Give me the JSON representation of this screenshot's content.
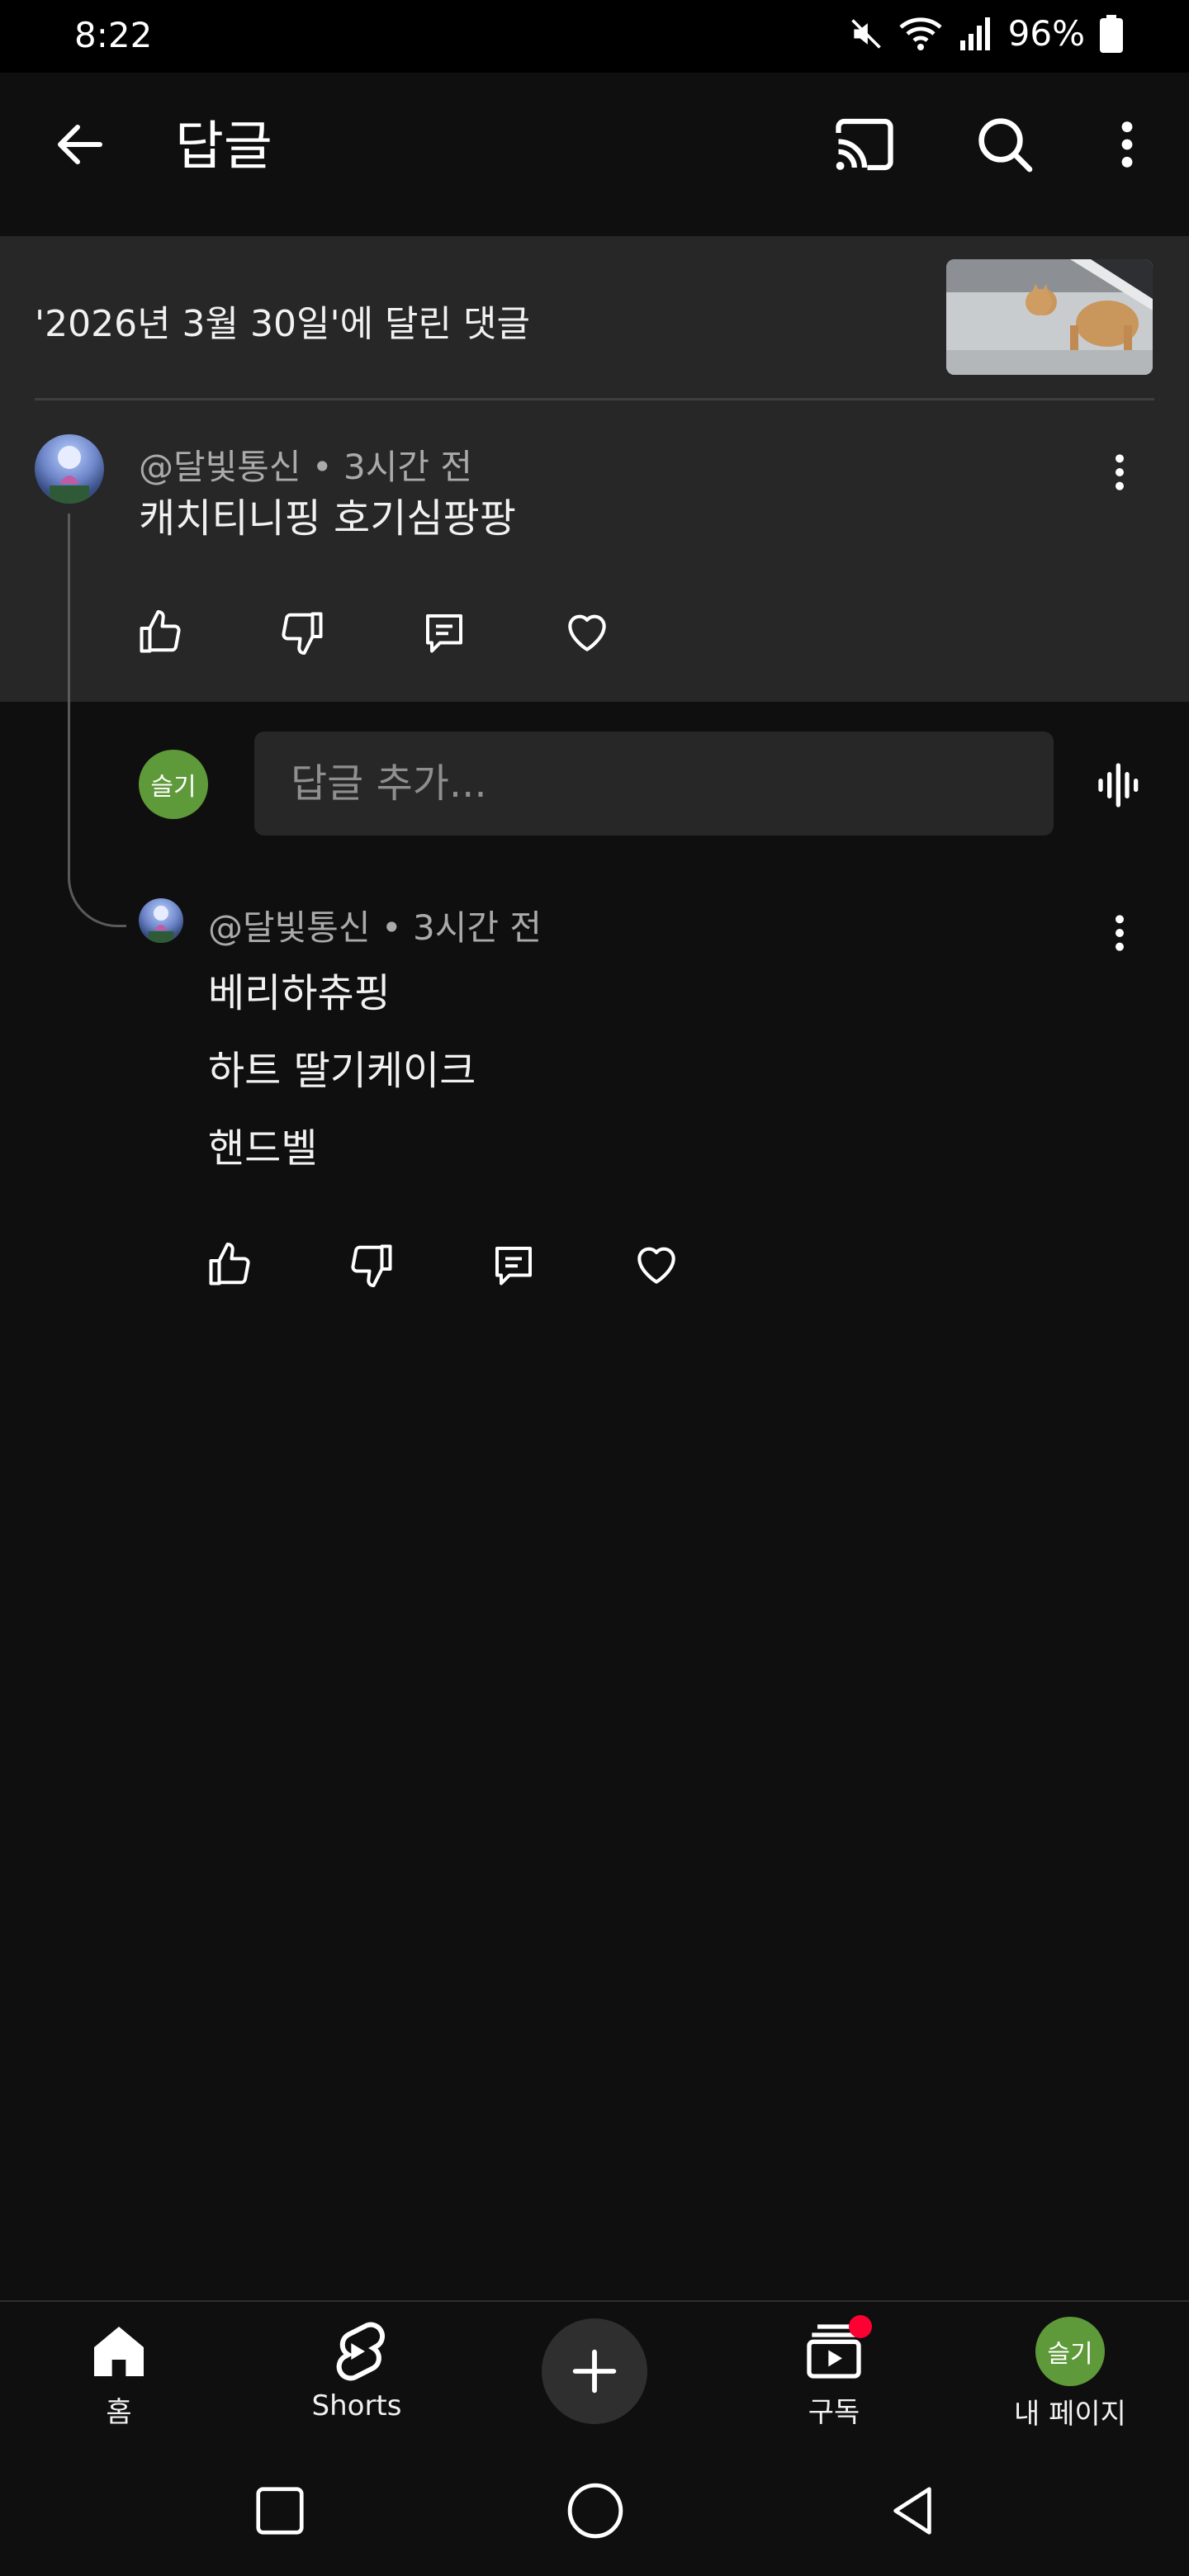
{
  "status_bar": {
    "time": "8:22",
    "battery_percent": "96%",
    "icons": [
      "mute-icon",
      "wifi-icon",
      "signal-icon",
      "battery-icon"
    ]
  },
  "app_bar": {
    "title": "답글",
    "icons": [
      "back-arrow-icon",
      "cast-icon",
      "search-icon",
      "more-vert-icon"
    ]
  },
  "video_header": {
    "context": "'2026년 3월 30일'에 달린 댓글"
  },
  "parent_comment": {
    "author": "@달빛통신",
    "time": "3시간 전",
    "meta": "@달빛통신 • 3시간 전",
    "text": "캐치티니핑 호기심팡팡"
  },
  "reply_box": {
    "user_initials": "슬기",
    "placeholder": "답글 추가..."
  },
  "replies": [
    {
      "author": "@달빛통신",
      "time": "3시간 전",
      "meta": "@달빛통신 • 3시간 전",
      "lines": [
        "베리하츄핑",
        "하트 딸기케이크",
        "핸드벨"
      ]
    }
  ],
  "bottom_nav": {
    "items": [
      {
        "label": "홈",
        "icon": "home-icon"
      },
      {
        "label": "Shorts",
        "icon": "shorts-icon"
      },
      {
        "label": "",
        "icon": "create-plus-icon"
      },
      {
        "label": "구독",
        "icon": "subscriptions-icon"
      },
      {
        "label": "내 페이지",
        "icon": "avatar"
      }
    ],
    "profile_initials": "슬기"
  },
  "colors": {
    "background": "#0f0f0f",
    "surface": "#272727",
    "text_primary": "#f1f1f1",
    "text_secondary": "#aaaaaa",
    "profile_green": "#5e9a39",
    "notification_red": "#ff0033"
  }
}
